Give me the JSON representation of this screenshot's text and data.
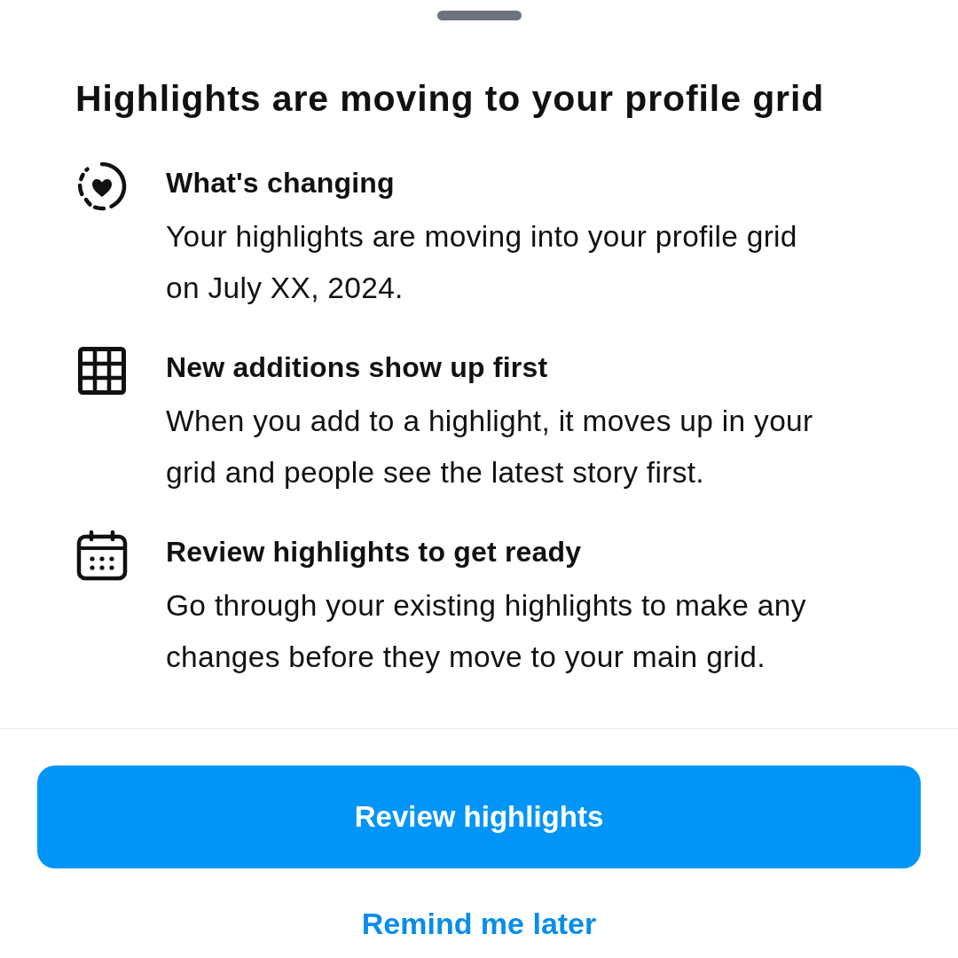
{
  "sheet": {
    "title": "Highlights are moving to your profile grid",
    "items": [
      {
        "kind": "heart",
        "heading": "What's changing",
        "text": "Your highlights are moving into your profile grid on July XX, 2024."
      },
      {
        "kind": "grid",
        "heading": "New additions show up first",
        "text": "When you add to a highlight, it moves up in your grid and people see the latest story first."
      },
      {
        "kind": "calendar",
        "heading": "Review highlights to get ready",
        "text": "Go through your existing highlights to make any changes before they move to your main grid."
      }
    ]
  },
  "actions": {
    "primary": "Review highlights",
    "secondary": "Remind me later"
  }
}
